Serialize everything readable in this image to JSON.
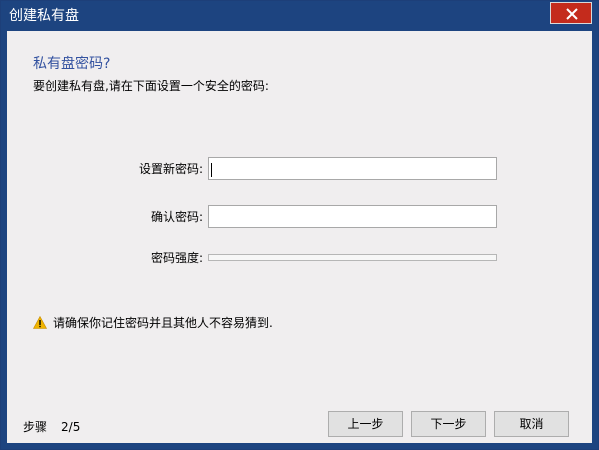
{
  "window": {
    "title": "创建私有盘"
  },
  "main": {
    "heading": "私有盘密码?",
    "subheading": "要创建私有盘,请在下面设置一个安全的密码:",
    "fields": {
      "new_password_label": "设置新密码:",
      "new_password_value": "",
      "confirm_password_label": "确认密码:",
      "confirm_password_value": "",
      "strength_label": "密码强度:",
      "strength_level": 0
    },
    "warning": "请确保你记住密码并且其他人不容易猜到."
  },
  "footer": {
    "step_label": "步骤",
    "step_value": "2/5",
    "buttons": {
      "prev": "上一步",
      "next": "下一步",
      "cancel": "取消"
    }
  },
  "colors": {
    "titlebar": "#1d4480",
    "close_button": "#c42b1c",
    "heading": "#3352a0",
    "client_background": "#f0eeef",
    "warning_icon": "#f0b400"
  },
  "icons": {
    "close": "close-icon",
    "warning": "warning-icon"
  }
}
